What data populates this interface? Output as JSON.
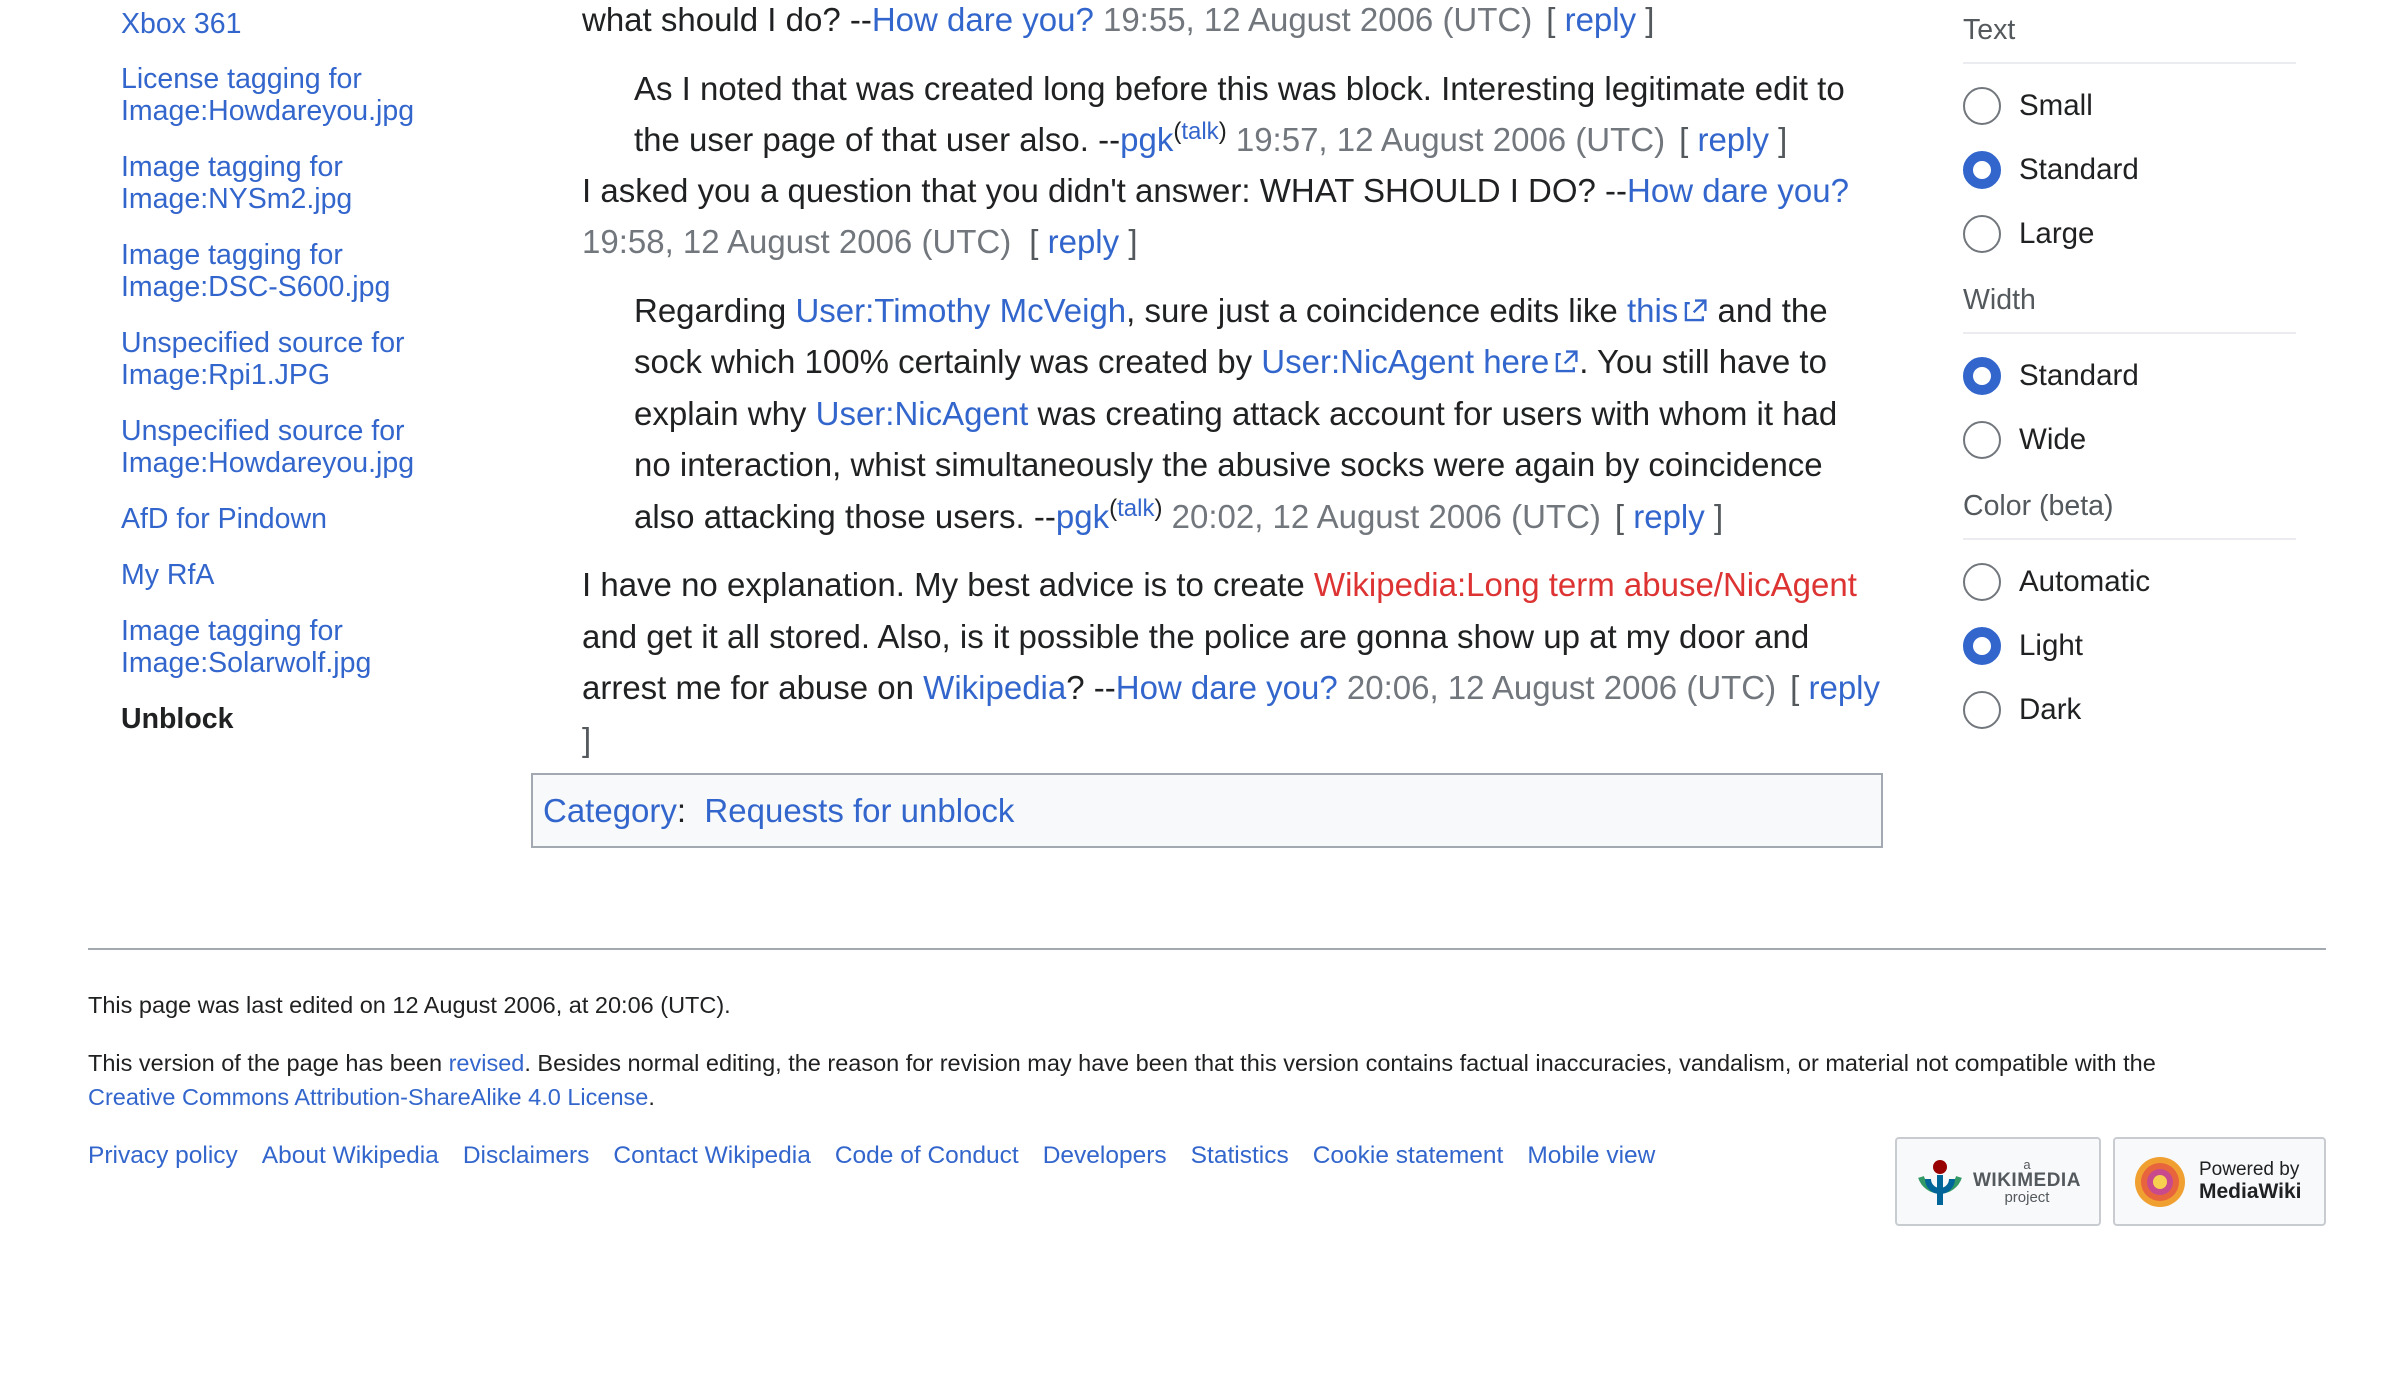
{
  "toc": {
    "items": [
      "Xbox 361",
      "License tagging for Image:Howdareyou.jpg",
      "Image tagging for Image:NYSm2.jpg",
      "Image tagging for Image:DSC-S600.jpg",
      "Unspecified source for Image:Rpi1.JPG",
      "Unspecified source for Image:Howdareyou.jpg",
      "AfD for Pindown",
      "My RfA",
      "Image tagging for Image:Solarwolf.jpg",
      "Unblock"
    ]
  },
  "posts": {
    "p1": {
      "text": "what should I do? --",
      "user": "How dare you?",
      "ts": " 19:55, 12 August 2006 (UTC)"
    },
    "p2": {
      "text": "As I noted that was created long before this was block. Interesting legitimate edit to the user page of that user also. --",
      "user": "pgk",
      "talk": "talk",
      "ts": " 19:57, 12 August 2006 (UTC)"
    },
    "p3": {
      "text": "I asked you a question that you didn't answer: WHAT SHOULD I DO? --",
      "user": "How dare you?",
      "ts": "19:58, 12 August 2006 (UTC)"
    },
    "p4": {
      "t1": "Regarding ",
      "l1": "User:Timothy McVeigh",
      "t2": ", sure just a coincidence edits like ",
      "l2": "this",
      "t3": " and the sock which 100% certainly was created by ",
      "l3": "User:NicAgent here",
      "t4": ". You still have to explain why ",
      "l4": "User:NicAgent",
      "t5": " was creating attack account for users with whom it had no interaction, whist simultaneously the abusive socks were again by coincidence also attacking those users. --",
      "user": "pgk",
      "talk": "talk",
      "ts": " 20:02, 12 August 2006 (UTC)"
    },
    "p5": {
      "t1": "I have no explanation. My best advice is to create ",
      "l1": "Wikipedia:Long term abuse/NicAgent",
      "t2": " and get it all stored. Also, is it possible the police are gonna show up at my door and arrest me for abuse on ",
      "l2": "Wikipedia",
      "t3": "? --",
      "user": "How dare you?",
      "ts": " 20:06, 12 August 2006 (UTC)"
    },
    "reply_label": "reply",
    "bracket_open": "[",
    "bracket_close": "]"
  },
  "category": {
    "label": "Category",
    "sep": ":",
    "value": "Requests for unblock"
  },
  "appearance": {
    "text_heading": "Text",
    "text_options": [
      "Small",
      "Standard",
      "Large"
    ],
    "text_selected": "Standard",
    "width_heading": "Width",
    "width_options": [
      "Standard",
      "Wide"
    ],
    "width_selected": "Standard",
    "color_heading": "Color (beta)",
    "color_options": [
      "Automatic",
      "Light",
      "Dark"
    ],
    "color_selected": "Light"
  },
  "footer": {
    "last_edited": "This page was last edited on 12 August 2006, at 20:06 (UTC).",
    "revised_pre": "This version of the page has been ",
    "revised_link": "revised",
    "revised_post": ". Besides normal editing, the reason for revision may have been that this version contains factual inaccuracies, vandalism, or material not compatible with the",
    "license_link": "Creative Commons Attribution-ShareAlike 4.0 License",
    "license_post": ".",
    "places": [
      "Privacy policy",
      "About Wikipedia",
      "Disclaimers",
      "Contact Wikipedia",
      "Code of Conduct",
      "Developers",
      "Statistics",
      "Cookie statement",
      "Mobile view"
    ],
    "wikimedia_small": "a",
    "wikimedia_name": "WIKIMEDIA",
    "wikimedia_sub": "project",
    "mediawiki_top": "Powered by",
    "mediawiki_name": "MediaWiki"
  },
  "colors": {
    "link": "#3366cc",
    "redlink": "#dd3333",
    "accent": "#3366cc",
    "text": "#202122"
  }
}
